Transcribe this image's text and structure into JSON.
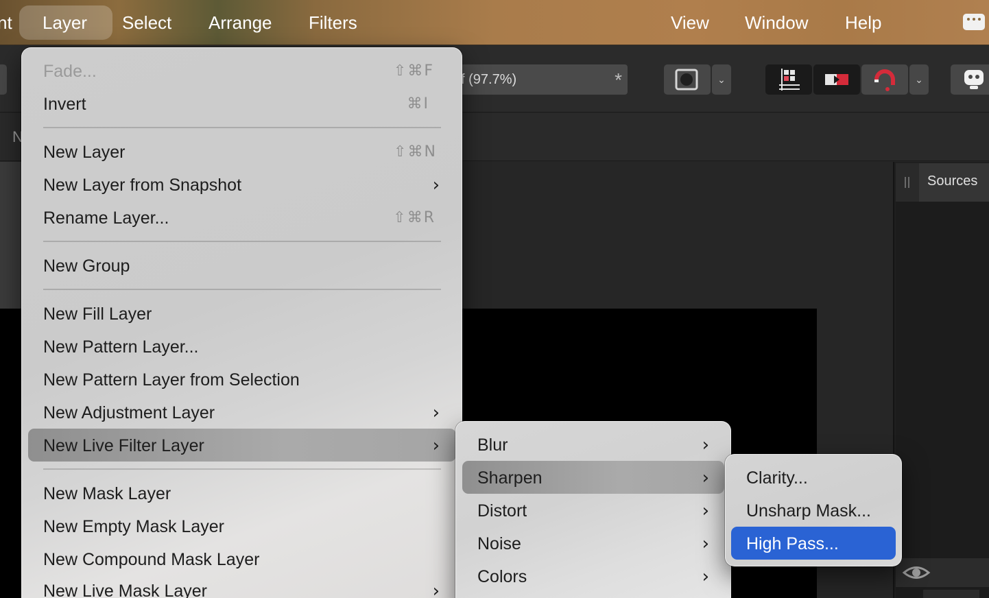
{
  "menubar": {
    "items": [
      "nt",
      "Layer",
      "Select",
      "Arrange",
      "Filters",
      "View",
      "Window",
      "Help"
    ],
    "active": "Layer"
  },
  "toolbar": {
    "zoom_text": "f (97.7%)",
    "zoom_star": "*"
  },
  "contextbar": {
    "label": "N"
  },
  "panel": {
    "tab_label": "Sources"
  },
  "layer_menu": {
    "items": [
      {
        "label": "Fade...",
        "shortcut": "⇧⌘F",
        "disabled": true
      },
      {
        "label": "Invert",
        "shortcut": "⌘I"
      },
      {
        "label": "New Layer",
        "shortcut": "⇧⌘N"
      },
      {
        "label": "New Layer from Snapshot",
        "submenu": true
      },
      {
        "label": "Rename Layer...",
        "shortcut": "⇧⌘R"
      },
      {
        "label": "New Group"
      },
      {
        "label": "New Fill Layer"
      },
      {
        "label": "New Pattern Layer..."
      },
      {
        "label": "New Pattern Layer from Selection"
      },
      {
        "label": "New Adjustment Layer",
        "submenu": true
      },
      {
        "label": "New Live Filter Layer",
        "submenu": true,
        "highlighted": true
      },
      {
        "label": "New Mask Layer"
      },
      {
        "label": "New Empty Mask Layer"
      },
      {
        "label": "New Compound Mask Layer"
      },
      {
        "label": "New Live Mask Layer",
        "submenu": true
      }
    ]
  },
  "filter_submenu": {
    "items": [
      {
        "label": "Blur",
        "submenu": true
      },
      {
        "label": "Sharpen",
        "submenu": true,
        "highlighted": true
      },
      {
        "label": "Distort",
        "submenu": true
      },
      {
        "label": "Noise",
        "submenu": true
      },
      {
        "label": "Colors",
        "submenu": true
      }
    ]
  },
  "sharpen_submenu": {
    "items": [
      {
        "label": "Clarity..."
      },
      {
        "label": "Unsharp Mask..."
      },
      {
        "label": "High Pass...",
        "selected": true
      }
    ]
  },
  "glyphs": {
    "submenu_arrow": "›",
    "chevron_down": "⌄",
    "eye": "◉"
  },
  "colors": {
    "selection_blue": "#2a63d4",
    "menubar_text": "#ffffff"
  }
}
